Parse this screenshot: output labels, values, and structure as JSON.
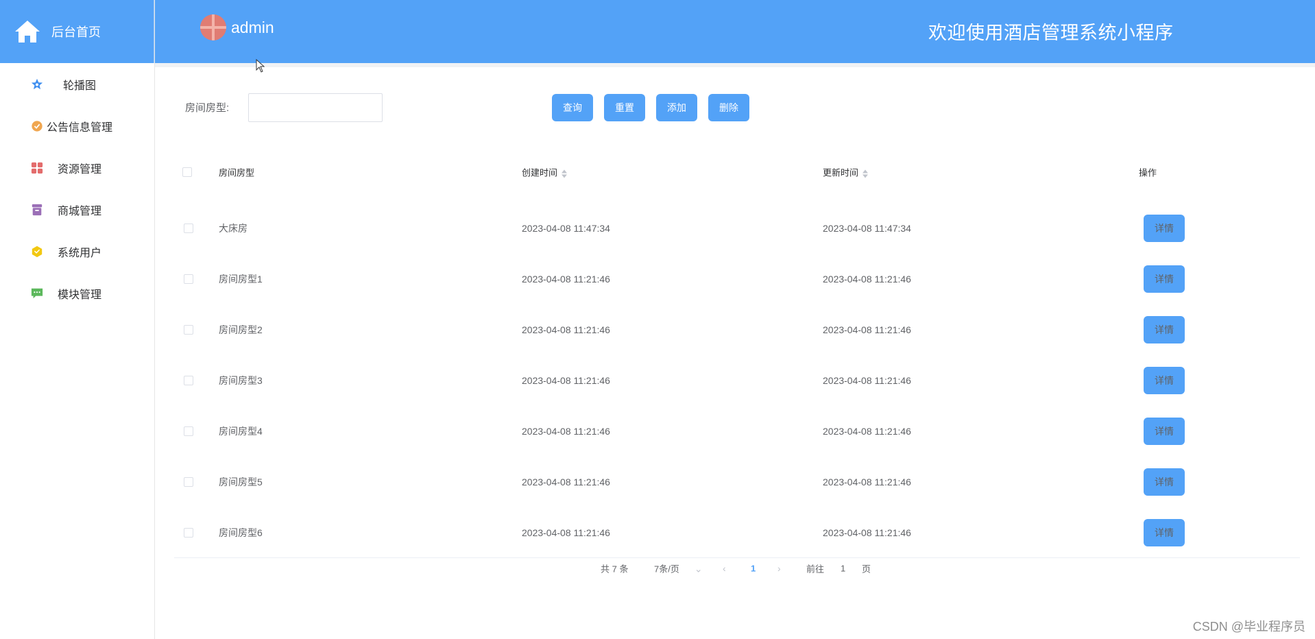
{
  "sidebar": {
    "home_label": "后台首页",
    "items": [
      {
        "label": "轮播图",
        "icon": "star-icon",
        "color": "#3f8ff0"
      },
      {
        "label": "公告信息管理",
        "icon": "badge-icon",
        "color": "#f0a650"
      },
      {
        "label": "资源管理",
        "icon": "grid-icon",
        "color": "#e36c6c"
      },
      {
        "label": "商城管理",
        "icon": "archive-icon",
        "color": "#9b6fb7"
      },
      {
        "label": "系统用户",
        "icon": "cube-icon",
        "color": "#f2c811"
      },
      {
        "label": "模块管理",
        "icon": "chat-icon",
        "color": "#5cb85c"
      }
    ]
  },
  "header": {
    "username": "admin",
    "welcome": "欢迎使用酒店管理系统小程序",
    "background": "#53a2f7"
  },
  "search": {
    "label": "房间房型:",
    "value": "",
    "placeholder": ""
  },
  "toolbar": {
    "query": "查询",
    "reset": "重置",
    "add": "添加",
    "delete": "删除"
  },
  "table": {
    "headers": {
      "type": "房间房型",
      "created": "创建时间",
      "updated": "更新时间",
      "actions": "操作"
    },
    "detail_label": "详情",
    "rows": [
      {
        "type": "大床房",
        "created": "2023-04-08 11:47:34",
        "updated": "2023-04-08 11:47:34"
      },
      {
        "type": "房间房型1",
        "created": "2023-04-08 11:21:46",
        "updated": "2023-04-08 11:21:46"
      },
      {
        "type": "房间房型2",
        "created": "2023-04-08 11:21:46",
        "updated": "2023-04-08 11:21:46"
      },
      {
        "type": "房间房型3",
        "created": "2023-04-08 11:21:46",
        "updated": "2023-04-08 11:21:46"
      },
      {
        "type": "房间房型4",
        "created": "2023-04-08 11:21:46",
        "updated": "2023-04-08 11:21:46"
      },
      {
        "type": "房间房型5",
        "created": "2023-04-08 11:21:46",
        "updated": "2023-04-08 11:21:46"
      },
      {
        "type": "房间房型6",
        "created": "2023-04-08 11:21:46",
        "updated": "2023-04-08 11:21:46"
      }
    ]
  },
  "pagination": {
    "total": "共 7 条",
    "page_size": "7条/页",
    "current_page": "1",
    "goto_prefix": "前往",
    "goto_value": "1",
    "goto_suffix": "页"
  },
  "watermark": "CSDN @毕业程序员"
}
